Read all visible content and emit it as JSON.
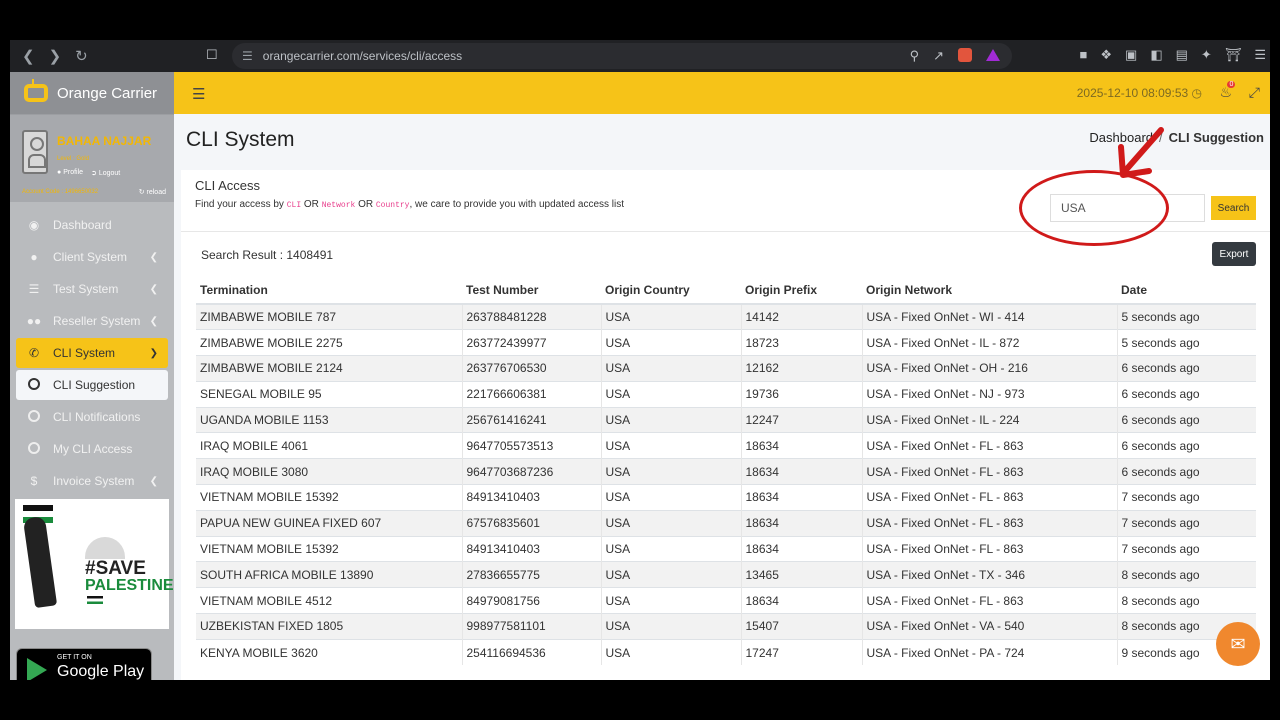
{
  "browser": {
    "url": "orangecarrier.com/services/cli/access"
  },
  "brand": {
    "name": "Orange Carrier"
  },
  "user": {
    "name": "BAHAA NAJJAR",
    "level": "Level : Gold",
    "profile_label": "Profile",
    "logout_label": "Logout",
    "account_code": "Account Code : 1496650032",
    "reload_label": "reload"
  },
  "sidebar": {
    "items": [
      {
        "label": "Dashboard",
        "icon": "dashboard-icon"
      },
      {
        "label": "Client System",
        "icon": "user-icon"
      },
      {
        "label": "Test System",
        "icon": "test-icon"
      },
      {
        "label": "Reseller System",
        "icon": "users-icon"
      },
      {
        "label": "CLI System",
        "icon": "phone-icon"
      },
      {
        "label": "CLI Suggestion",
        "icon": "circle-icon"
      },
      {
        "label": "CLI Notifications",
        "icon": "circle-icon"
      },
      {
        "label": "My CLI Access",
        "icon": "circle-icon"
      },
      {
        "label": "Invoice System",
        "icon": "dollar-icon"
      }
    ]
  },
  "banner": {
    "line1": "#SAVE",
    "line2": "PALESTINE"
  },
  "gplay": {
    "small": "GET IT ON",
    "big": "Google Play"
  },
  "topbar": {
    "datetime": "2025-12-10 08:09:53",
    "notif_count": "0"
  },
  "page": {
    "title": "CLI System",
    "breadcrumb_home": "Dashboard",
    "breadcrumb_sep": "/",
    "breadcrumb_current": "CLI Suggestion"
  },
  "card": {
    "title": "CLI Access",
    "desc_1": "Find your access by",
    "code_cli": "CLI",
    "or_1": "OR",
    "code_network": "Network",
    "or_2": "OR",
    "code_country": "Country",
    "desc_2": ", we care to provide you with updated access list",
    "search_value": "USA",
    "search_button": "Search",
    "search_result": "Search Result : 1408491",
    "export_button": "Export"
  },
  "table": {
    "headers": [
      "Termination",
      "Test Number",
      "Origin Country",
      "Origin Prefix",
      "Origin Network",
      "Date"
    ],
    "rows": [
      [
        "ZIMBABWE MOBILE 787",
        "263788481228",
        "USA",
        "14142",
        "USA - Fixed OnNet - WI - 414",
        "5 seconds ago"
      ],
      [
        "ZIMBABWE MOBILE 2275",
        "263772439977",
        "USA",
        "18723",
        "USA - Fixed OnNet - IL - 872",
        "5 seconds ago"
      ],
      [
        "ZIMBABWE MOBILE 2124",
        "263776706530",
        "USA",
        "12162",
        "USA - Fixed OnNet - OH - 216",
        "6 seconds ago"
      ],
      [
        "SENEGAL MOBILE 95",
        "221766606381",
        "USA",
        "19736",
        "USA - Fixed OnNet - NJ - 973",
        "6 seconds ago"
      ],
      [
        "UGANDA MOBILE 1153",
        "256761416241",
        "USA",
        "12247",
        "USA - Fixed OnNet - IL - 224",
        "6 seconds ago"
      ],
      [
        "IRAQ MOBILE 4061",
        "9647705573513",
        "USA",
        "18634",
        "USA - Fixed OnNet - FL - 863",
        "6 seconds ago"
      ],
      [
        "IRAQ MOBILE 3080",
        "9647703687236",
        "USA",
        "18634",
        "USA - Fixed OnNet - FL - 863",
        "6 seconds ago"
      ],
      [
        "VIETNAM MOBILE 15392",
        "84913410403",
        "USA",
        "18634",
        "USA - Fixed OnNet - FL - 863",
        "7 seconds ago"
      ],
      [
        "PAPUA NEW GUINEA FIXED 607",
        "67576835601",
        "USA",
        "18634",
        "USA - Fixed OnNet - FL - 863",
        "7 seconds ago"
      ],
      [
        "VIETNAM MOBILE 15392",
        "84913410403",
        "USA",
        "18634",
        "USA - Fixed OnNet - FL - 863",
        "7 seconds ago"
      ],
      [
        "SOUTH AFRICA MOBILE 13890",
        "27836655775",
        "USA",
        "13465",
        "USA - Fixed OnNet - TX - 346",
        "8 seconds ago"
      ],
      [
        "VIETNAM MOBILE 4512",
        "84979081756",
        "USA",
        "18634",
        "USA - Fixed OnNet - FL - 863",
        "8 seconds ago"
      ],
      [
        "UZBEKISTAN FIXED 1805",
        "998977581101",
        "USA",
        "15407",
        "USA - Fixed OnNet - VA - 540",
        "8 seconds ago"
      ],
      [
        "KENYA MOBILE 3620",
        "254116694536",
        "USA",
        "17247",
        "USA - Fixed OnNet - PA - 724",
        "9 seconds ago"
      ]
    ]
  }
}
